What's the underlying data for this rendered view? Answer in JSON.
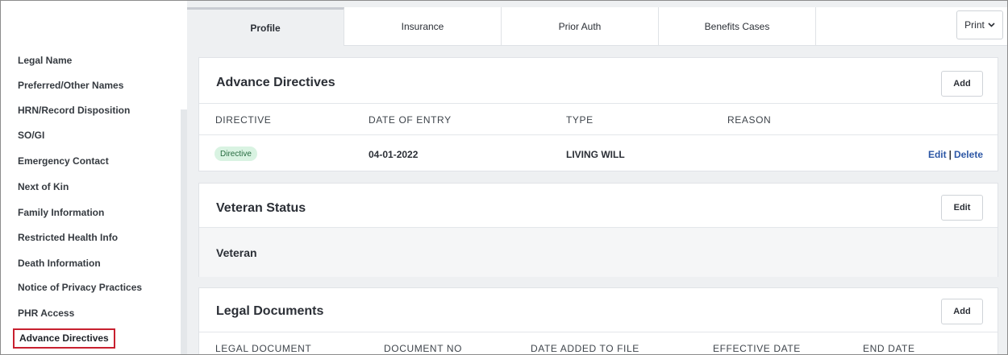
{
  "sidebar": {
    "items": [
      {
        "label": "Legal Name"
      },
      {
        "label": "Preferred/Other Names"
      },
      {
        "label": "HRN/Record Disposition"
      },
      {
        "label": "SO/GI"
      },
      {
        "label": "Emergency Contact"
      },
      {
        "label": "Next of Kin"
      },
      {
        "label": "Family Information"
      },
      {
        "label": "Restricted Health Info"
      },
      {
        "label": "Death Information"
      },
      {
        "label": "Notice of Privacy Practices"
      },
      {
        "label": "PHR Access"
      },
      {
        "label": "Advance Directives",
        "active": true
      }
    ]
  },
  "tabs": [
    {
      "label": "Profile",
      "selected": true
    },
    {
      "label": "Insurance"
    },
    {
      "label": "Prior Auth"
    },
    {
      "label": "Benefits Cases"
    }
  ],
  "print_button": {
    "label": "Print",
    "icon": "chevron-down-icon"
  },
  "advance_directives": {
    "title": "Advance Directives",
    "add_label": "Add",
    "columns": [
      "DIRECTIVE",
      "DATE OF ENTRY",
      "TYPE",
      "REASON"
    ],
    "rows": [
      {
        "badge": "Directive",
        "date_of_entry": "04-01-2022",
        "type": "LIVING WILL",
        "reason": "",
        "edit_label": "Edit",
        "separator": "|",
        "delete_label": "Delete"
      }
    ]
  },
  "veteran_status": {
    "title": "Veteran Status",
    "edit_label": "Edit",
    "value": "Veteran"
  },
  "legal_documents": {
    "title": "Legal Documents",
    "add_label": "Add",
    "columns": [
      "LEGAL DOCUMENT",
      "DOCUMENT NO",
      "DATE ADDED TO FILE",
      "EFFECTIVE DATE",
      "END DATE"
    ]
  },
  "colors": {
    "active_outline": "#c8202f",
    "link": "#2e58a6",
    "badge_bg": "#d9f3e2",
    "badge_text": "#256a3f",
    "page_bg": "#eef0f2"
  }
}
